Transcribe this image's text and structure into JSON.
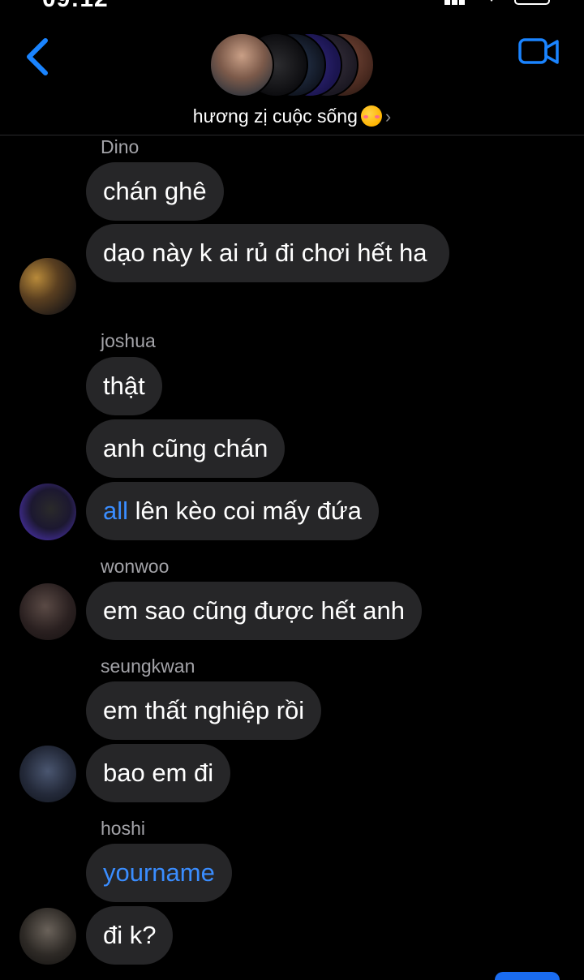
{
  "status": {
    "time": "09:12"
  },
  "header": {
    "title": "hương zị cuộc sống",
    "title_emoji": "smiling-face-with-hearts-emoji",
    "back_icon": "chevron-left-icon",
    "video_icon": "video-camera-icon",
    "accent": "#1a84ff"
  },
  "messages": [
    {
      "sender": "Dino",
      "bubbles": [
        {
          "text": "chán ghê"
        },
        {
          "text": "dạo này k ai rủ đi chơi hết ha"
        }
      ]
    },
    {
      "sender": "joshua",
      "bubbles": [
        {
          "text": "thật"
        },
        {
          "text": "anh cũng chán"
        },
        {
          "mention": "all",
          "text": " lên kèo coi mấy đứa"
        }
      ]
    },
    {
      "sender": "wonwoo",
      "bubbles": [
        {
          "text": "em sao cũng được hết anh"
        }
      ]
    },
    {
      "sender": "seungkwan",
      "bubbles": [
        {
          "text": "em thất nghiệp rồi"
        },
        {
          "text": "bao em đi"
        }
      ]
    },
    {
      "sender": "hoshi",
      "bubbles": [
        {
          "mention": "yourname"
        },
        {
          "text": "đi k?"
        }
      ]
    }
  ],
  "colors": {
    "bubble": "#262628",
    "mention": "#3a8dff",
    "background": "#000000"
  }
}
